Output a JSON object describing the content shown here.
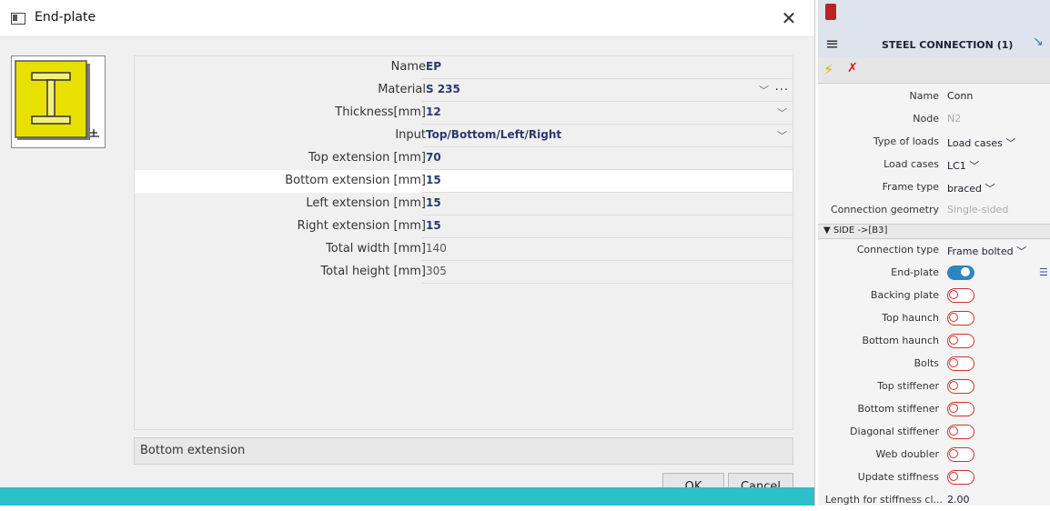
{
  "dialog": {
    "title": "End-plate",
    "close_label": "✕",
    "properties": [
      {
        "label": "Name",
        "value": "EP",
        "bold": true
      },
      {
        "label": "Material",
        "value": "S 235",
        "bold": true
      },
      {
        "label": "Thickness[mm]",
        "value": "12",
        "bold": true
      },
      {
        "label": "Input",
        "value": "Top/Bottom/Left/Right",
        "bold": true
      },
      {
        "label": "Top extension [mm]",
        "value": "70",
        "bold": true
      },
      {
        "label": "Bottom extension [mm]",
        "value": "15",
        "bold": true
      },
      {
        "label": "Left extension [mm]",
        "value": "15",
        "bold": true
      },
      {
        "label": "Right extension [mm]",
        "value": "15",
        "bold": true
      },
      {
        "label": "Total width [mm]",
        "value": "140",
        "bold": false
      },
      {
        "label": "Total height [mm]",
        "value": "305",
        "bold": false
      }
    ],
    "material_more": "...",
    "description": "Bottom extension",
    "ok_label": "OK",
    "cancel_label": "Cancel"
  },
  "panel": {
    "title": "STEEL CONNECTION (1)",
    "general": [
      {
        "label": "Name",
        "value": "Conn"
      },
      {
        "label": "Node",
        "value": "N2",
        "disabled": true
      },
      {
        "label": "Type of loads",
        "value": "Load cases ﹀"
      },
      {
        "label": "Load cases",
        "value": "LC1 ﹀"
      },
      {
        "label": "Frame type",
        "value": "braced ﹀"
      },
      {
        "label": "Connection geometry",
        "value": "Single-sided",
        "disabled": true
      }
    ],
    "side_header": "▼  SIDE ->[B3]",
    "connection_type": {
      "label": "Connection type",
      "value": "Frame bolted ﹀"
    },
    "toggles": [
      {
        "label": "End-plate",
        "on": true
      },
      {
        "label": "Backing plate",
        "on": false
      },
      {
        "label": "Top haunch",
        "on": false
      },
      {
        "label": "Bottom haunch",
        "on": false
      },
      {
        "label": "Bolts",
        "on": false
      },
      {
        "label": "Top stiffener",
        "on": false
      },
      {
        "label": "Bottom stiffener",
        "on": false
      },
      {
        "label": "Diagonal stiffener",
        "on": false
      },
      {
        "label": "Web doubler",
        "on": false
      },
      {
        "label": "Update stiffness",
        "on": false
      }
    ],
    "length_row": {
      "label": "Length for stiffness cl...",
      "value": "2.00"
    }
  },
  "colors": {
    "accent": "#2cc0c8",
    "toggle_on": "#2e86c1",
    "toggle_off": "#d03030",
    "value_text": "#2a3a6a"
  }
}
